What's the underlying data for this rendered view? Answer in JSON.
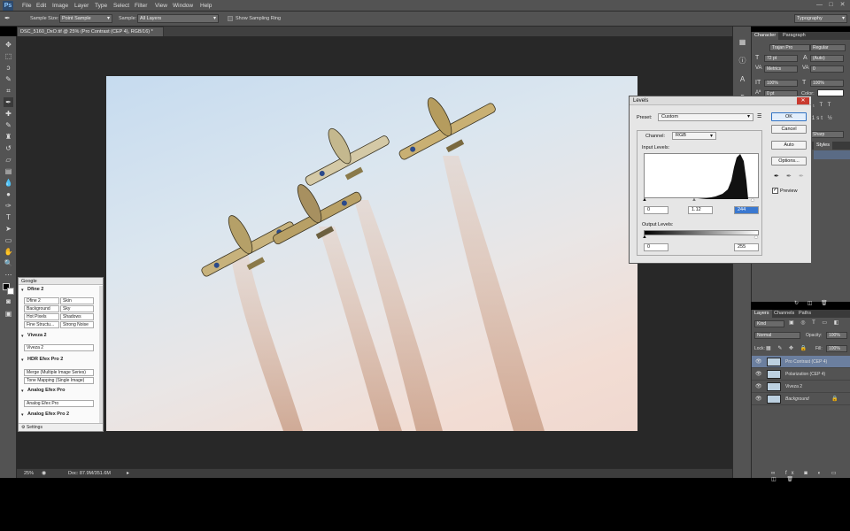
{
  "app": {
    "logo": "Ps"
  },
  "menu": [
    "File",
    "Edit",
    "Image",
    "Layer",
    "Type",
    "Select",
    "Filter",
    "View",
    "Window",
    "Help"
  ],
  "window_controls": [
    "—",
    "□",
    "✕"
  ],
  "options": {
    "sample_size_label": "Sample Size:",
    "sample_size_value": "Point Sample",
    "sample_label": "Sample:",
    "sample_value": "All Layers",
    "show_ring_label": "Show Sampling Ring",
    "workspace": "Typography"
  },
  "document": {
    "tab_title": "DSC_5160_DxO.tif @ 25% (Pro Contrast (CEP 4), RGB/16) *"
  },
  "status": {
    "zoom": "25%",
    "doc": "Doc: 87.9M/351.6M"
  },
  "google_panel": {
    "title": "Google",
    "dfine": {
      "title": "Dfine 2",
      "buttons": [
        "Dfine 2",
        "Skin",
        "Background",
        "Sky",
        "Hot Pixels",
        "Shadows",
        "Fine Structu...",
        "Strong Noise"
      ]
    },
    "viveza": {
      "title": "Viveza 2",
      "buttons": [
        "Viveza 2"
      ]
    },
    "hdr": {
      "title": "HDR Efex Pro 2",
      "buttons": [
        "Merge (Multiple Image Series)",
        "Tone Mapping (Single Image)"
      ]
    },
    "analog": {
      "title": "Analog Efex Pro",
      "buttons": [
        "Analog Efex Pro"
      ]
    },
    "analog2": {
      "title": "Analog Efex Pro 2"
    },
    "settings": "Settings"
  },
  "character_panel": {
    "tab_character": "Character",
    "tab_paragraph": "Paragraph",
    "font": "Trajan Pro",
    "style": "Regular",
    "size": "72 pt",
    "leading": "(Auto)",
    "tracking_mode": "Metrics",
    "tracking": "0",
    "vscale": "100%",
    "hscale": "100%",
    "baseline": "0 pt",
    "color_label": "Color:",
    "aa": "Sharp",
    "styles_tab": "Styles"
  },
  "layers_panel": {
    "tabs": [
      "Layers",
      "Channels",
      "Paths"
    ],
    "kind": "Kind",
    "blend": "Normal",
    "opacity_label": "Opacity:",
    "opacity": "100%",
    "lock_label": "Lock:",
    "fill_label": "Fill:",
    "fill": "100%",
    "layers": [
      {
        "name": "Pro Contrast (CEP 4)",
        "selected": true
      },
      {
        "name": "Polarization (CEP 4)",
        "selected": false
      },
      {
        "name": "Viveza 2",
        "selected": false
      },
      {
        "name": "Background",
        "selected": false
      }
    ]
  },
  "levels": {
    "title": "Levels",
    "preset_label": "Preset:",
    "preset": "Custom",
    "channel_label": "Channel:",
    "channel": "RGB",
    "input_label": "Input Levels:",
    "input_black": "0",
    "input_gamma": "1.12",
    "input_white": "244",
    "output_label": "Output Levels:",
    "output_black": "0",
    "output_white": "255",
    "buttons": {
      "ok": "OK",
      "cancel": "Cancel",
      "auto": "Auto",
      "options": "Options..."
    },
    "preview_label": "Preview"
  },
  "colors": {
    "accent": "#2f72c4",
    "panel": "#535353",
    "canvas": "#282828"
  }
}
